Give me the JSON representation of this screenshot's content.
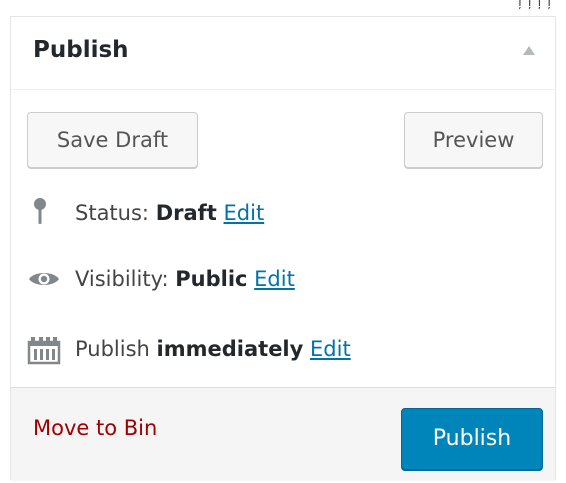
{
  "colors": {
    "accent": "#0085ba",
    "link": "#0073aa",
    "trash": "#a00000",
    "icon": "#82878c"
  },
  "stray_text": "ļ ļ ļ ļ",
  "publish_box": {
    "title": "Publish",
    "toggle_icon": "triangle-up-icon",
    "save_draft_label": "Save Draft",
    "preview_label": "Preview",
    "status": {
      "icon": "pin-icon",
      "label": "Status:",
      "value": "Draft",
      "edit_label": "Edit"
    },
    "visibility": {
      "icon": "eye-icon",
      "label": "Visibility:",
      "value": "Public",
      "edit_label": "Edit"
    },
    "schedule": {
      "icon": "calendar-icon",
      "label": "Publish",
      "value": "immediately",
      "edit_label": "Edit"
    },
    "trash_label": "Move to Bin",
    "publish_label": "Publish"
  }
}
